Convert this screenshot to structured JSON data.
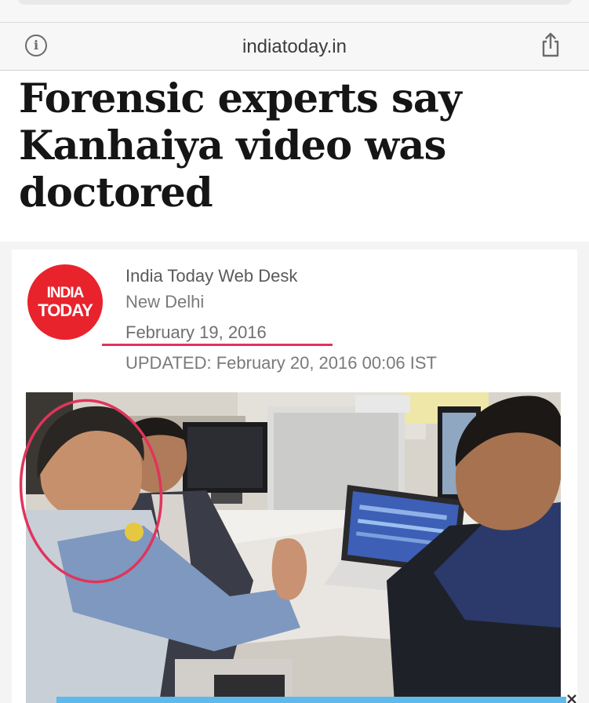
{
  "browser": {
    "url": "indiatoday.in",
    "icons": [
      "info-icon",
      "share-icon"
    ]
  },
  "article": {
    "headline": "Forensic experts say Kanhaiya video was doctored",
    "logo": {
      "line1": "INDIA",
      "line2": "TODAY"
    },
    "author": "India Today Web Desk",
    "location": "New Delhi",
    "date": "February 19, 2016",
    "updated": "UPDATED: February 20, 2016 00:06 IST"
  },
  "colors": {
    "brand_red": "#e8232c",
    "annotation": "#e0345c",
    "overlay": "#5fb9ea"
  }
}
